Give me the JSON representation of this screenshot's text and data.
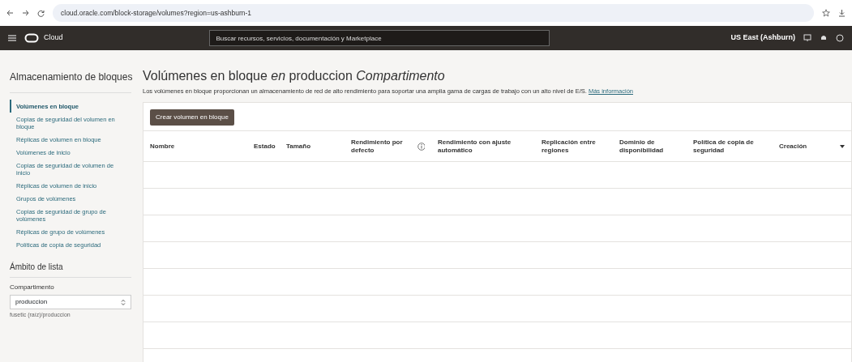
{
  "browser": {
    "url": "cloud.oracle.com/block-storage/volumes?region=us-ashburn-1"
  },
  "topbar": {
    "brand": "Cloud",
    "search": {
      "placeholder": "Buscar recursos, servicios, documentación y Marketplace"
    },
    "region": "US East (Ashburn)"
  },
  "sidebar": {
    "title": "Almacenamiento de bloques",
    "items": [
      {
        "label": "Volúmenes en bloque",
        "selected": true
      },
      {
        "label": "Copias de seguridad del volumen en bloque",
        "selected": false
      },
      {
        "label": "Réplicas de volumen en bloque",
        "selected": false
      },
      {
        "label": "Volúmenes de inicio",
        "selected": false
      },
      {
        "label": "Copias de seguridad de volumen de inicio",
        "selected": false
      },
      {
        "label": "Réplicas de volumen de inicio",
        "selected": false
      },
      {
        "label": "Grupos de volúmenes",
        "selected": false
      },
      {
        "label": "Copias de seguridad de grupo de volúmenes",
        "selected": false
      },
      {
        "label": "Réplicas de grupo de volúmenes",
        "selected": false
      },
      {
        "label": "Políticas de copia de seguridad",
        "selected": false
      }
    ],
    "scope": {
      "title": "Ámbito de lista",
      "field_label": "Compartimento",
      "value": "produccion",
      "path": "fusetic (raíz)/produccion"
    }
  },
  "main": {
    "title": "Volúmenes en bloque *en* produccion *Compartimento*",
    "description": "Los volúmenes en bloque proporcionan un almacenamiento de red de alto rendimiento para soportar una amplia gama de cargas de trabajo con un alto nivel de E/S.",
    "link": "Más información",
    "create_button": "Crear volumen en bloque",
    "table": {
      "columns": [
        "Nombre",
        "Estado",
        "Tamaño",
        "Rendimiento por defecto",
        "Rendimiento con ajuste automático",
        "Replicación entre regiones",
        "Dominio de disponibilidad",
        "Política de copia de seguridad",
        "Creación"
      ]
    }
  }
}
